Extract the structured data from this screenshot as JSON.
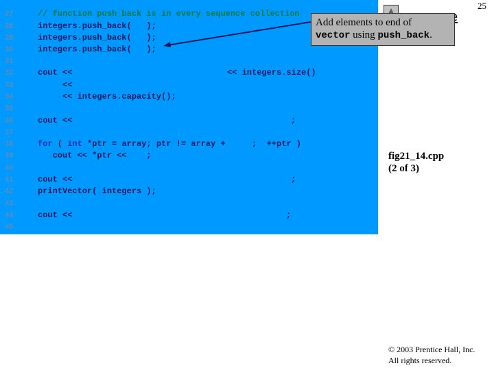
{
  "slide": {
    "page_number": "25",
    "outline_title_fragment": "e",
    "file_label": "fig21_14.cpp",
    "file_part": "(2 of 3)",
    "copyright_line1": "© 2003 Prentice Hall, Inc.",
    "copyright_line2": "All rights reserved."
  },
  "callout": {
    "text_before": "Add elements to end of",
    "code1": "vector",
    "text_mid": " using ",
    "code2": "push_back",
    "text_end": "."
  },
  "code_lines": [
    {
      "num": "27",
      "text": "// function push_back is in every sequence collection"
    },
    {
      "num": "28",
      "text": "integers.push_back(   );"
    },
    {
      "num": "29",
      "text": "integers.push_back(   );"
    },
    {
      "num": "30",
      "text": "integers.push_back(   );"
    },
    {
      "num": "31",
      "text": ""
    },
    {
      "num": "32",
      "text": "cout <<"
    },
    {
      "num": "33",
      "text": "     <<"
    },
    {
      "num": "34",
      "text": "     << integers.capacity();"
    },
    {
      "num": "35",
      "text": ""
    },
    {
      "num": "36",
      "text": "cout <<"
    },
    {
      "num": "37",
      "text": ""
    },
    {
      "num": "38",
      "text_kw1": "for",
      "text_p1": " ( ",
      "text_kw2": "int",
      "text_p2": " *ptr = array; ptr != array +"
    },
    {
      "num": "39",
      "text": "   cout << *ptr <<    ;"
    },
    {
      "num": "40",
      "text": ""
    },
    {
      "num": "41",
      "text": "cout <<"
    },
    {
      "num": "42",
      "text": "printVector( integers );"
    },
    {
      "num": "43",
      "text": ""
    },
    {
      "num": "44",
      "text": "cout <<"
    },
    {
      "num": "45",
      "text": ""
    }
  ],
  "fragments": {
    "line32_right": "<< integers.size()",
    "line36_right": ";",
    "line38_right": ";  ++ptr )",
    "line41_right": ";",
    "line44_right": ";"
  }
}
